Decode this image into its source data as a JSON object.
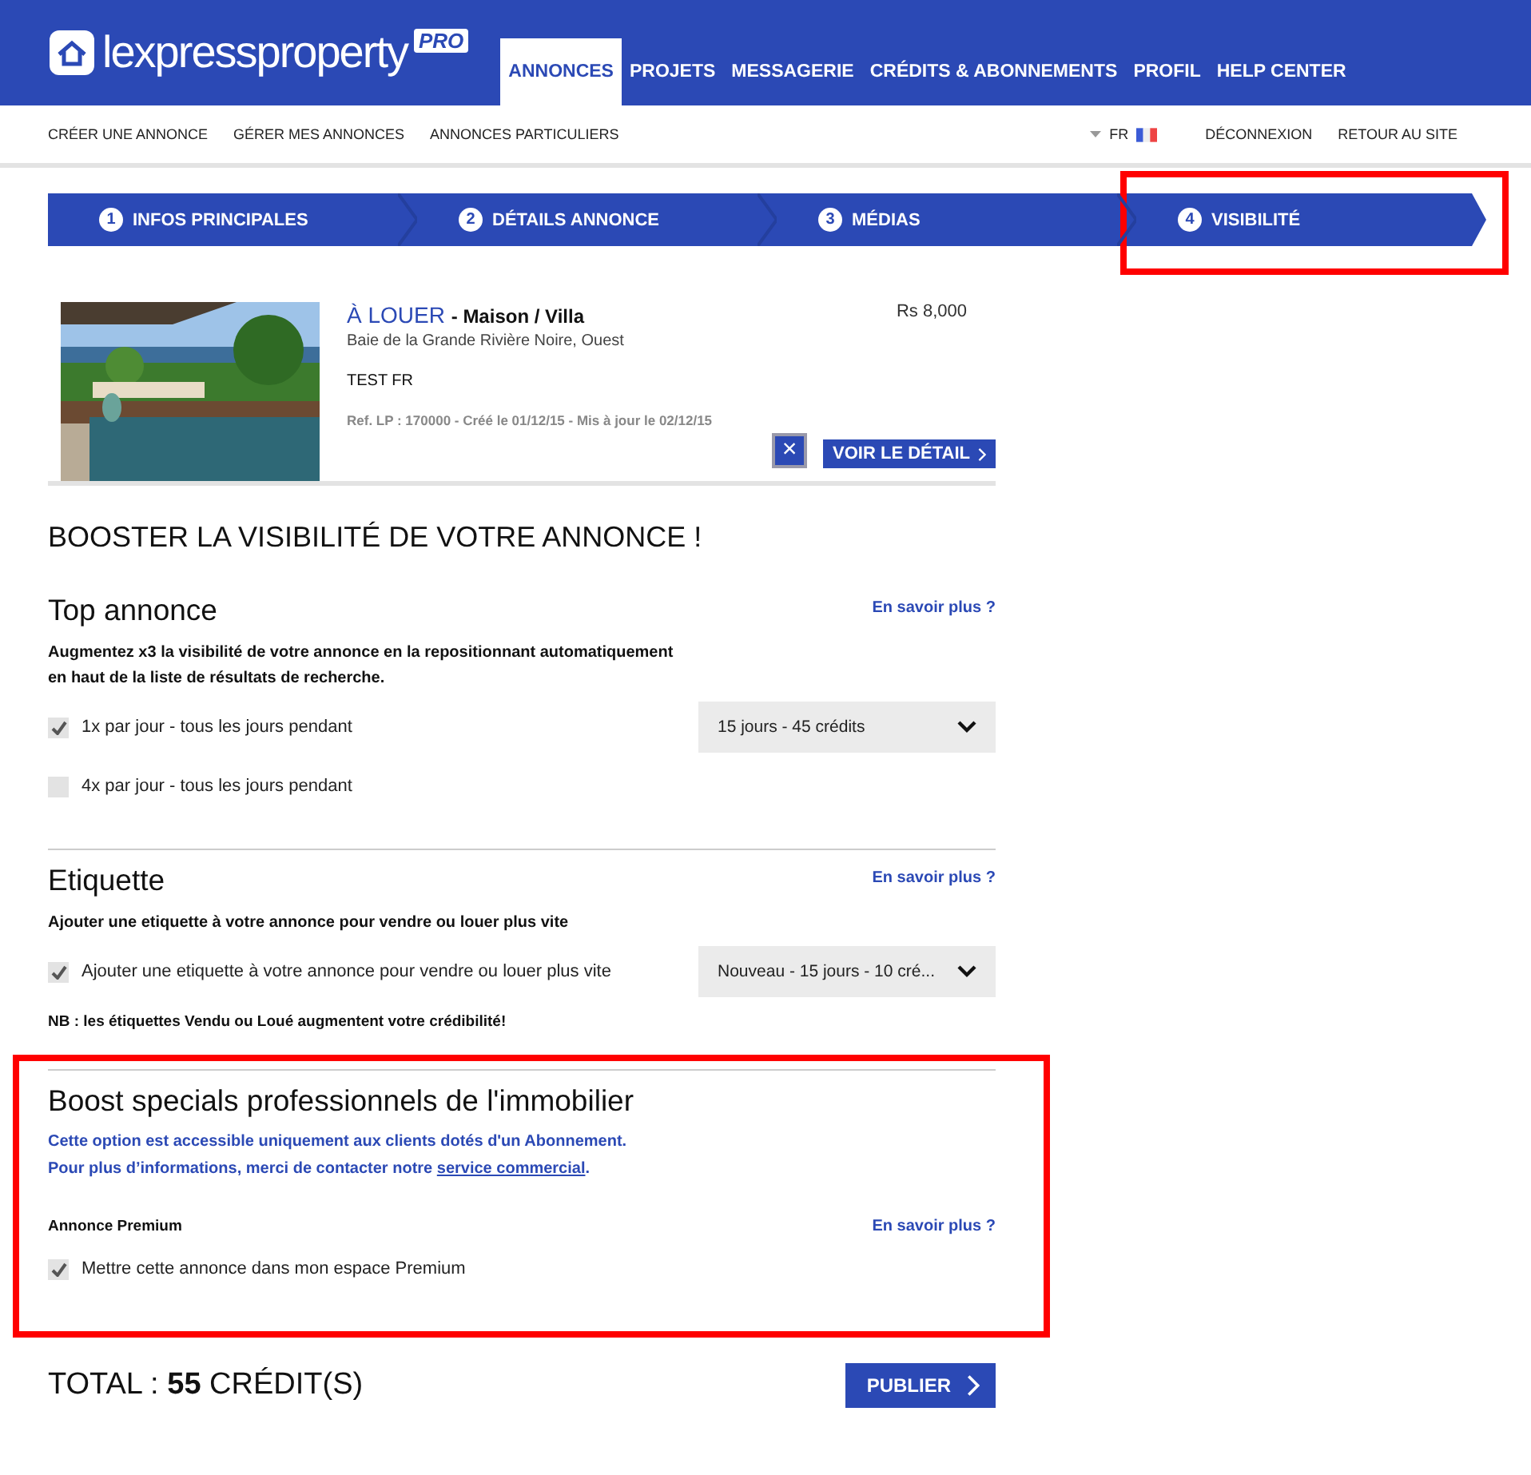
{
  "header": {
    "logo": "lexpressproperty",
    "logo_badge": "PRO",
    "nav": [
      {
        "label": "ANNONCES",
        "selected": true
      },
      {
        "label": "PROJETS",
        "selected": false
      },
      {
        "label": "MESSAGERIE",
        "selected": false
      },
      {
        "label": "CRÉDITS & ABONNEMENTS",
        "selected": false
      },
      {
        "label": "PROFIL",
        "selected": false
      },
      {
        "label": "HELP CENTER",
        "selected": false
      }
    ]
  },
  "subnav": {
    "links": [
      "CRÉER UNE ANNONCE",
      "GÉRER MES ANNONCES",
      "ANNONCES PARTICULIERS"
    ],
    "language": "FR",
    "account_links": [
      "DÉCONNEXION",
      "RETOUR AU SITE"
    ]
  },
  "steps": [
    {
      "number": "1",
      "label": "INFOS PRINCIPALES"
    },
    {
      "number": "2",
      "label": "DÉTAILS ANNONCE"
    },
    {
      "number": "3",
      "label": "MÉDIAS"
    },
    {
      "number": "4",
      "label": "VISIBILITÉ",
      "highlighted": true
    }
  ],
  "listing": {
    "transaction": "À LOUER",
    "type": "- Maison / Villa",
    "location": "Baie de la Grande Rivière Noire, Ouest",
    "title": "TEST FR",
    "reference": "Ref. LP : 170000 - Créé le 01/12/15 - Mis à jour le 02/12/15",
    "price": "Rs 8,000",
    "remove_button": "×",
    "detail_button": "VOIR LE DÉTAIL"
  },
  "heading": "BOOSTER LA VISIBILITÉ DE VOTRE ANNONCE !",
  "sections": [
    {
      "title": "Top annonce",
      "more_link": "En savoir plus ?",
      "description": "Augmentez x3 la visibilité de votre annonce en la repositionnant automatiquement en haut de la liste de résultats de recherche.",
      "options": [
        {
          "label": "1x par jour - tous les jours pendant",
          "checked": true,
          "dropdown": "15 jours - 45 crédits"
        },
        {
          "label": "4x par jour - tous les jours pendant",
          "checked": false
        }
      ]
    },
    {
      "title": "Etiquette",
      "more_link": "En savoir plus ?",
      "description": "Ajouter une etiquette à votre annonce pour vendre ou louer plus vite",
      "options": [
        {
          "label": "Ajouter une etiquette à votre annonce pour vendre ou louer plus vite",
          "checked": true,
          "dropdown": "Nouveau - 15 jours - 10 cré..."
        }
      ],
      "note": "NB : les étiquettes Vendu ou Loué augmentent votre crédibilité!"
    },
    {
      "title": "Boost specials professionnels de l'immobilier",
      "highlighted": true,
      "info_lines": [
        "Cette option est accessible uniquement aux clients dotés d'un Abonnement.",
        "Pour plus d’informations, merci de contacter notre"
      ],
      "info_link": "service commercial",
      "info_end": ".",
      "subtitle": "Annonce Premium",
      "more_link": "En savoir plus ?",
      "options": [
        {
          "label": "Mettre cette annonce dans mon espace Premium",
          "checked": true
        }
      ]
    }
  ],
  "total": {
    "label": "TOTAL :",
    "amount": "55",
    "unit": "CRÉDIT(S)"
  },
  "publish_button": "PUBLIER"
}
